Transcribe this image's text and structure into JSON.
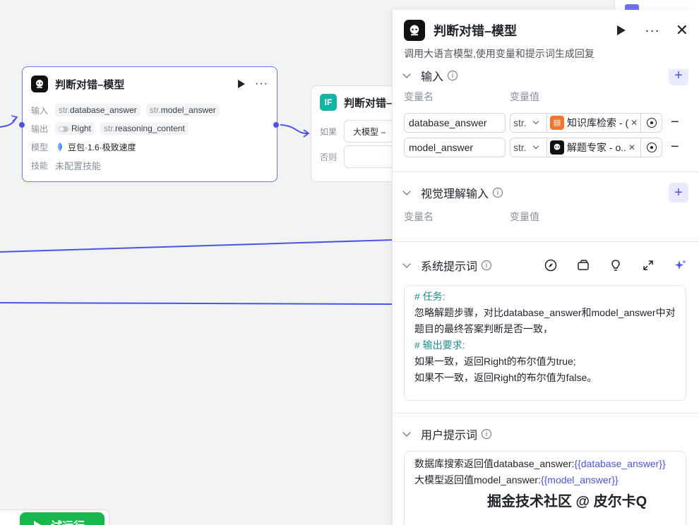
{
  "canvas": {
    "llm_node": {
      "title": "判断对错–模型",
      "input_label": "输入",
      "inputs": [
        {
          "type": "str.",
          "name": "database_answer"
        },
        {
          "type": "str.",
          "name": "model_answer"
        }
      ],
      "output_label": "输出",
      "outputs": [
        {
          "type": "",
          "name": "Right"
        },
        {
          "type": "str.",
          "name": "reasoning_content"
        }
      ],
      "model_label": "模型",
      "model_value": "豆包·1.6·极致速度",
      "skill_label": "技能",
      "skill_value": "未配置技能"
    },
    "condition_node": {
      "badge": "IF",
      "title": "判断对错–",
      "if_label": "如果",
      "if_value": "大模型 –",
      "else_label": "否则"
    },
    "test_run_label": "试运行"
  },
  "panel": {
    "title": "判断对错–模型",
    "description": "调用大语言模型,使用变量和提示词生成回复",
    "input_section": {
      "title": "输入",
      "col_name": "变量名",
      "col_value": "变量值",
      "rows": [
        {
          "name": "database_answer",
          "type": "str.",
          "ref_icon": "knowledge-icon",
          "ref_text": "知识库检索 - (",
          "ref_color": "#f2772e"
        },
        {
          "name": "model_answer",
          "type": "str.",
          "ref_icon": "bot-icon",
          "ref_text": "解题专家 - o..",
          "ref_color": "#111111"
        }
      ]
    },
    "vision_section": {
      "title": "视觉理解输入",
      "col_name": "变量名",
      "col_value": "变量值"
    },
    "system_prompt": {
      "title": "系统提示词",
      "lines": [
        {
          "text": "# 任务:",
          "kind": "heading"
        },
        {
          "text": "忽略解题步骤，对比database_answer和model_answer中对题目的最终答案判断是否一致，",
          "kind": "text"
        },
        {
          "text": "# 输出要求:",
          "kind": "heading"
        },
        {
          "text": "如果一致，返回Right的布尔值为true;",
          "kind": "text"
        },
        {
          "text": "如果不一致，返回Right的布尔值为false。",
          "kind": "text"
        }
      ]
    },
    "user_prompt": {
      "title": "用户提示词",
      "line1_prefix": "数据库搜索返回值database_answer:",
      "line1_var": "{{database_answer}}",
      "line2_prefix": "大模型返回值model_answer:",
      "line2_var": "{{model_answer}}"
    }
  },
  "watermark": "掘金技术社区 @ 皮尔卡Q",
  "colors": {
    "accent": "#4d53e8",
    "node_border": "#6e6ff5",
    "test_run": "#19b84c",
    "md_heading": "#1d8c8c"
  }
}
